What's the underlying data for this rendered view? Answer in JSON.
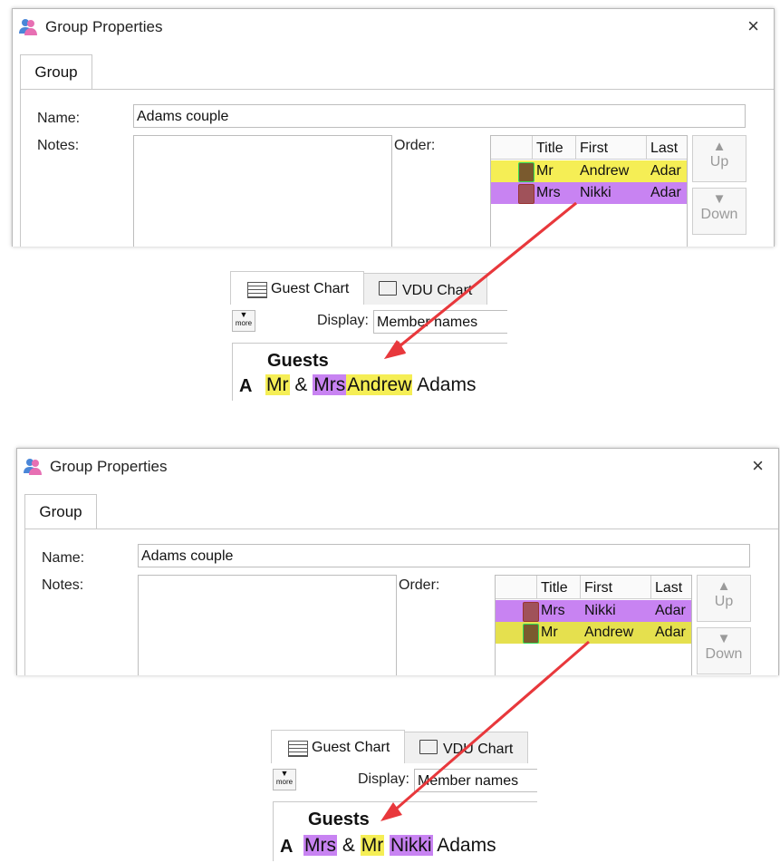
{
  "colors": {
    "yellow": "#f5ee55",
    "purple": "#c883f2",
    "arrow": "#e8383c",
    "pinkIcon": "#e76fb3",
    "blueIcon": "#4a86d8"
  },
  "panels": [
    {
      "dialog": {
        "title": "Group Properties",
        "close": "×",
        "tab": "Group",
        "name_label": "Name:",
        "name_value": "Adams couple",
        "notes_label": "Notes:",
        "order_label": "Order:",
        "columns": [
          "Title",
          "First",
          "Last"
        ],
        "rows": [
          {
            "title": "Mr",
            "first": "Andrew",
            "last": "Adar",
            "color": "yellow"
          },
          {
            "title": "Mrs",
            "first": "Nikki",
            "last": "Adar",
            "color": "purple"
          }
        ],
        "up_label": "Up",
        "down_label": "Down"
      },
      "chart": {
        "tabs": [
          "Guest Chart",
          "VDU Chart"
        ],
        "more_label": "more",
        "display_label": "Display:",
        "display_value": "Member names",
        "heading": "Guests",
        "letter": "A",
        "line": [
          "Mr",
          "&",
          "Mrs",
          "Andrew",
          "Adams"
        ]
      }
    },
    {
      "dialog": {
        "title": "Group Properties",
        "close": "×",
        "tab": "Group",
        "name_label": "Name:",
        "name_value": "Adams couple",
        "notes_label": "Notes:",
        "order_label": "Order:",
        "columns": [
          "Title",
          "First",
          "Last"
        ],
        "rows": [
          {
            "title": "Mrs",
            "first": "Nikki",
            "last": "Adar",
            "color": "purple"
          },
          {
            "title": "Mr",
            "first": "Andrew",
            "last": "Adar",
            "color": "yellow"
          }
        ],
        "up_label": "Up",
        "down_label": "Down"
      },
      "chart": {
        "tabs": [
          "Guest Chart",
          "VDU Chart"
        ],
        "more_label": "more",
        "display_label": "Display:",
        "display_value": "Member names",
        "heading": "Guests",
        "letter": "A",
        "line": [
          "Mrs",
          "&",
          "Mr",
          "Nikki",
          "Adams"
        ]
      }
    }
  ]
}
